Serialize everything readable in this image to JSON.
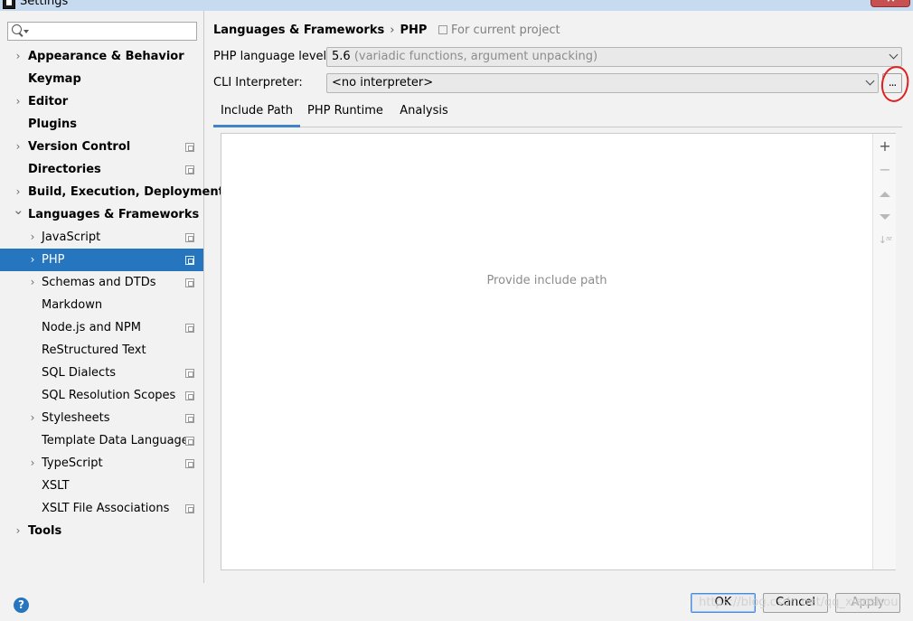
{
  "window": {
    "title": "Settings"
  },
  "search": {
    "value": ""
  },
  "tree": [
    {
      "label": "Appearance & Behavior",
      "level": 0,
      "bold": true,
      "chevron": "right",
      "project": false
    },
    {
      "label": "Keymap",
      "level": 0,
      "bold": true,
      "chevron": "",
      "project": false
    },
    {
      "label": "Editor",
      "level": 0,
      "bold": true,
      "chevron": "right",
      "project": false
    },
    {
      "label": "Plugins",
      "level": 0,
      "bold": true,
      "chevron": "",
      "project": false
    },
    {
      "label": "Version Control",
      "level": 0,
      "bold": true,
      "chevron": "right",
      "project": true
    },
    {
      "label": "Directories",
      "level": 0,
      "bold": true,
      "chevron": "",
      "project": true
    },
    {
      "label": "Build, Execution, Deployment",
      "level": 0,
      "bold": true,
      "chevron": "right",
      "project": false
    },
    {
      "label": "Languages & Frameworks",
      "level": 0,
      "bold": true,
      "chevron": "down",
      "project": false
    },
    {
      "label": "JavaScript",
      "level": 1,
      "bold": false,
      "chevron": "right",
      "project": true
    },
    {
      "label": "PHP",
      "level": 1,
      "bold": false,
      "chevron": "right",
      "project": true,
      "selected": true
    },
    {
      "label": "Schemas and DTDs",
      "level": 1,
      "bold": false,
      "chevron": "right",
      "project": true
    },
    {
      "label": "Markdown",
      "level": 1,
      "bold": false,
      "chevron": "",
      "project": false
    },
    {
      "label": "Node.js and NPM",
      "level": 1,
      "bold": false,
      "chevron": "",
      "project": true
    },
    {
      "label": "ReStructured Text",
      "level": 1,
      "bold": false,
      "chevron": "",
      "project": false
    },
    {
      "label": "SQL Dialects",
      "level": 1,
      "bold": false,
      "chevron": "",
      "project": true
    },
    {
      "label": "SQL Resolution Scopes",
      "level": 1,
      "bold": false,
      "chevron": "",
      "project": true
    },
    {
      "label": "Stylesheets",
      "level": 1,
      "bold": false,
      "chevron": "right",
      "project": true
    },
    {
      "label": "Template Data Languages",
      "level": 1,
      "bold": false,
      "chevron": "",
      "project": true
    },
    {
      "label": "TypeScript",
      "level": 1,
      "bold": false,
      "chevron": "right",
      "project": true
    },
    {
      "label": "XSLT",
      "level": 1,
      "bold": false,
      "chevron": "",
      "project": false
    },
    {
      "label": "XSLT File Associations",
      "level": 1,
      "bold": false,
      "chevron": "",
      "project": true
    },
    {
      "label": "Tools",
      "level": 0,
      "bold": true,
      "chevron": "right",
      "project": false
    }
  ],
  "breadcrumb": {
    "parent": "Languages & Frameworks",
    "separator": "›",
    "current": "PHP"
  },
  "scope_hint": "For current project",
  "php_level": {
    "label": "PHP language level:",
    "value": "5.6",
    "hint": "(variadic functions, argument unpacking)"
  },
  "cli": {
    "label": "CLI Interpreter:",
    "value": "<no interpreter>",
    "browse": "..."
  },
  "tabs": [
    "Include Path",
    "PHP Runtime",
    "Analysis"
  ],
  "active_tab": "Include Path",
  "include_panel": {
    "empty_text": "Provide include path"
  },
  "toolbar_icons": [
    "add-icon",
    "remove-icon",
    "move-up-icon",
    "move-down-icon",
    "sort-icon"
  ],
  "buttons": {
    "help": "?",
    "ok": "OK",
    "cancel": "Cancel",
    "apply": "Apply"
  },
  "watermark": "https://blog.csdn.net/qq_xiaoshou",
  "colors": {
    "selection": "#2675bf",
    "accent_tab": "#4083c9",
    "annotation": "#e02020"
  }
}
